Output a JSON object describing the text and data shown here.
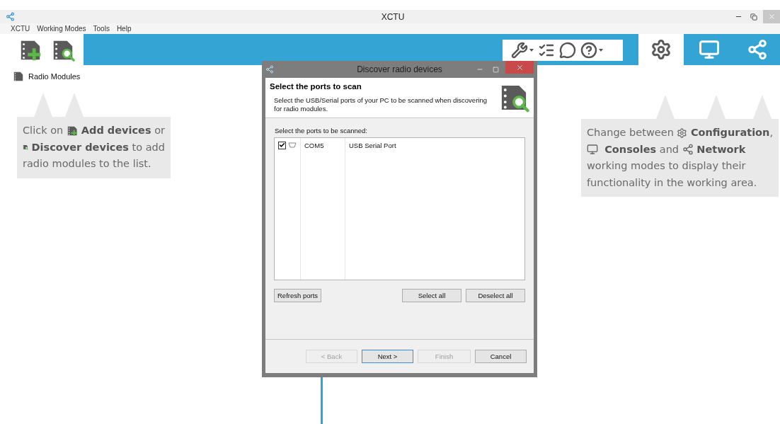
{
  "window": {
    "title": "XCTU"
  },
  "menu": [
    "XCTU",
    "Working Modes",
    "Tools",
    "Help"
  ],
  "device_buttons": [
    {
      "kind": "add"
    },
    {
      "kind": "discover"
    }
  ],
  "tools": [
    {
      "kind": "tools",
      "dropdown": true
    },
    {
      "kind": "list",
      "dropdown": false
    },
    {
      "kind": "chat",
      "dropdown": false
    },
    {
      "kind": "help",
      "dropdown": true
    }
  ],
  "mode_tabs": [
    {
      "kind": "configuration",
      "selected": true
    },
    {
      "kind": "consoles",
      "selected": false
    },
    {
      "kind": "network",
      "selected": false
    }
  ],
  "sidebar": {
    "items": [
      {
        "label": "Radio Modules"
      }
    ]
  },
  "callouts": [
    {
      "lines": [
        [
          {
            "kind": "text",
            "text": "Click on "
          },
          {
            "kind": "add"
          },
          {
            "kind": "text",
            "text": " **Add devices** or"
          }
        ],
        [
          {
            "kind": "discover"
          },
          {
            "kind": "text",
            "text": " **Discover devices** to add"
          }
        ],
        [
          {
            "kind": "text",
            "text": "radio modules to the list."
          }
        ]
      ]
    },
    {
      "lines": [
        [
          {
            "kind": "text",
            "text": "Change between "
          },
          {
            "kind": "configuration"
          },
          {
            "kind": "text",
            "text": " **Configuration**,"
          }
        ],
        [
          {
            "kind": "consoles"
          },
          {
            "kind": "text",
            "text": "  **Consoles** and "
          },
          {
            "kind": "network"
          },
          {
            "kind": "text",
            "text": " **Network**"
          }
        ],
        [
          {
            "kind": "text",
            "text": "working modes to display their"
          }
        ],
        [
          {
            "kind": "text",
            "text": "functionality in the working area."
          }
        ]
      ]
    }
  ],
  "dialog": {
    "title": "Discover radio devices",
    "heading": "Select the ports to scan",
    "description": "Select the USB/Serial ports of your PC to be scanned when discovering for radio modules.",
    "list_label": "Select the ports to be scanned:",
    "ports": [
      {
        "checked": true,
        "port": "COM5",
        "description": "USB Serial Port"
      }
    ],
    "list_buttons": [
      {
        "label": "Refresh ports"
      },
      {
        "label": "Select all"
      },
      {
        "label": "Deselect all"
      }
    ],
    "nav_buttons": [
      {
        "label": "< Back",
        "disabled": true,
        "default": false
      },
      {
        "label": "Next >",
        "disabled": false,
        "default": true
      },
      {
        "label": "Finish",
        "disabled": true,
        "default": false
      },
      {
        "label": "Cancel",
        "disabled": false,
        "default": false
      }
    ]
  }
}
